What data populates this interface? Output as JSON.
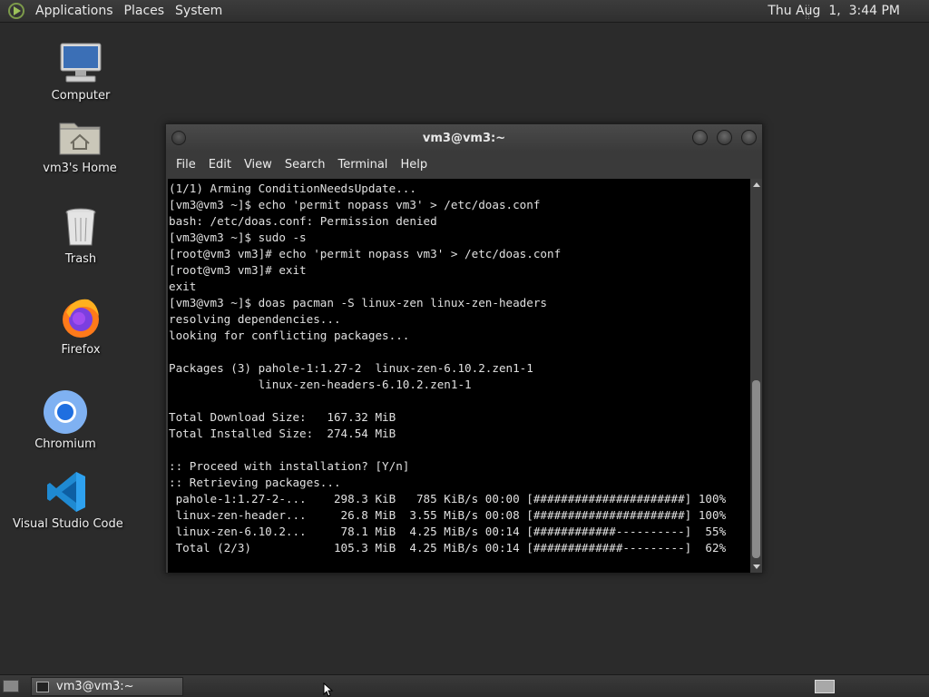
{
  "top_panel": {
    "menus": [
      "Applications",
      "Places",
      "System"
    ],
    "clock": "Thu Aug  1,  3:44 PM"
  },
  "desktop_icons": [
    {
      "label": "Computer",
      "icon": "computer-icon"
    },
    {
      "label": "vm3's Home",
      "icon": "home-folder-icon"
    },
    {
      "label": "Trash",
      "icon": "trash-icon"
    },
    {
      "label": "Firefox",
      "icon": "firefox-icon"
    },
    {
      "label": "Chromium",
      "icon": "chromium-icon"
    },
    {
      "label": "Visual Studio Code",
      "icon": "vscode-icon"
    }
  ],
  "terminal": {
    "title": "vm3@vm3:~",
    "menus": [
      "File",
      "Edit",
      "View",
      "Search",
      "Terminal",
      "Help"
    ],
    "lines": [
      "(1/1) Arming ConditionNeedsUpdate...",
      "[vm3@vm3 ~]$ echo 'permit nopass vm3' > /etc/doas.conf",
      "bash: /etc/doas.conf: Permission denied",
      "[vm3@vm3 ~]$ sudo -s",
      "[root@vm3 vm3]# echo 'permit nopass vm3' > /etc/doas.conf",
      "[root@vm3 vm3]# exit",
      "exit",
      "[vm3@vm3 ~]$ doas pacman -S linux-zen linux-zen-headers",
      "resolving dependencies...",
      "looking for conflicting packages...",
      "",
      "Packages (3) pahole-1:1.27-2  linux-zen-6.10.2.zen1-1",
      "             linux-zen-headers-6.10.2.zen1-1",
      "",
      "Total Download Size:   167.32 MiB",
      "Total Installed Size:  274.54 MiB",
      "",
      ":: Proceed with installation? [Y/n]",
      ":: Retrieving packages...",
      " pahole-1:1.27-2-...    298.3 KiB   785 KiB/s 00:00 [######################] 100%",
      " linux-zen-header...     26.8 MiB  3.55 MiB/s 00:08 [######################] 100%",
      " linux-zen-6.10.2...     78.1 MiB  4.25 MiB/s 00:14 [############----------]  55%",
      " Total (2/3)            105.3 MiB  4.25 MiB/s 00:14 [#############---------]  62%"
    ]
  },
  "taskbar": {
    "window_button": "vm3@vm3:~"
  },
  "colors": {
    "desktop": "#2b2b2b",
    "terminal_bg": "#000000",
    "terminal_fg": "#e0e0e0"
  }
}
